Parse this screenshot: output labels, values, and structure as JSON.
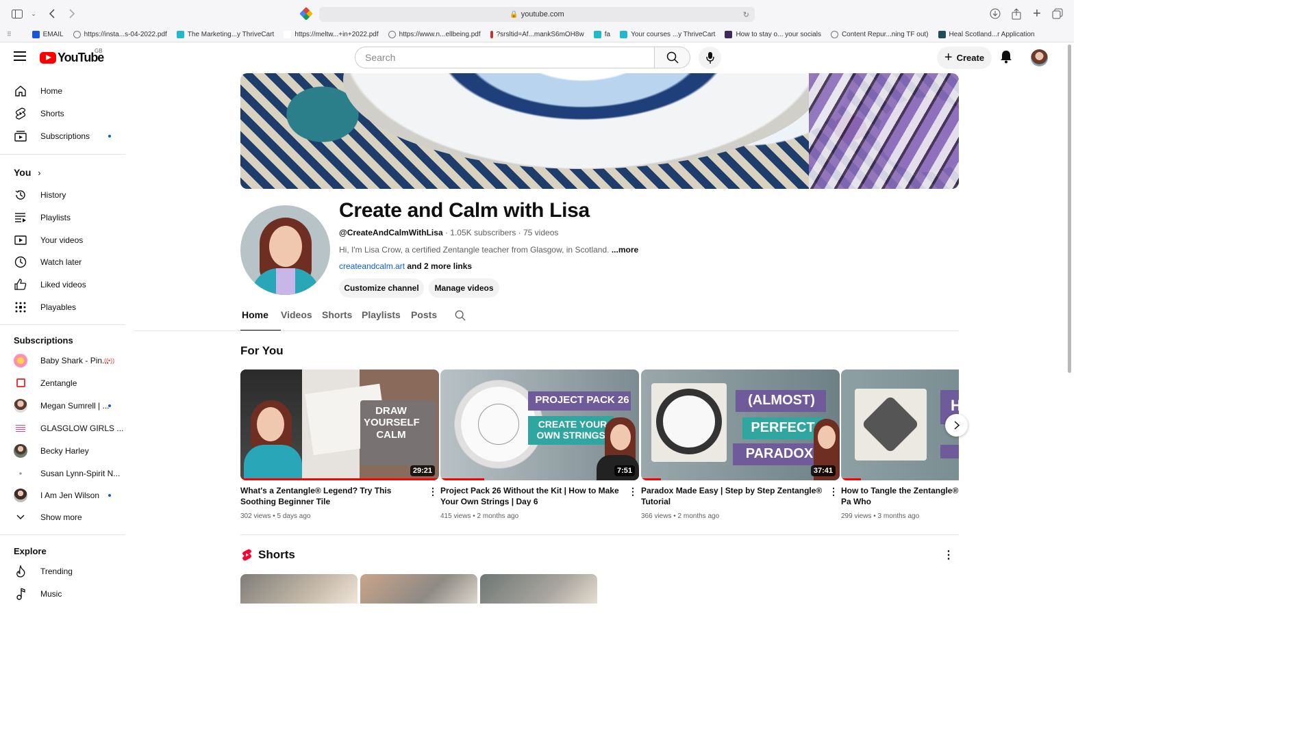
{
  "browser": {
    "url": "youtube.com",
    "bookmarks": [
      {
        "label": "EMAIL",
        "color": "#1a56db"
      },
      {
        "label": "https://insta...s-04-2022.pdf",
        "color": "#777777"
      },
      {
        "label": "The Marketing...y ThriveCart",
        "color": "#22b8cf"
      },
      {
        "label": "https://meltw...+in+2022.pdf",
        "color": "#ffffff"
      },
      {
        "label": "https://www.n...ellbeing.pdf",
        "color": "#777777"
      },
      {
        "label": "?srsltid=Af...mankS6mOH8w",
        "color": "#c0392b"
      },
      {
        "label": "fa",
        "color": "#22b8cf"
      },
      {
        "label": "Your courses ...y ThriveCart",
        "color": "#22b8cf"
      },
      {
        "label": "How to stay o... your socials",
        "color": "#3b2a5a"
      },
      {
        "label": "Content Repur...ning TF out)",
        "color": "#777777"
      },
      {
        "label": "Heal Scotland...r Application",
        "color": "#1f4e5a"
      }
    ]
  },
  "header": {
    "logo_text": "YouTube",
    "region": "GB",
    "search_placeholder": "Search",
    "create_label": "Create"
  },
  "sidebar": {
    "main": [
      {
        "label": "Home",
        "icon": "home-icon"
      },
      {
        "label": "Shorts",
        "icon": "shorts-icon"
      },
      {
        "label": "Subscriptions",
        "icon": "subscriptions-icon"
      }
    ],
    "you_label": "You",
    "you_items": [
      {
        "label": "History",
        "icon": "history-icon"
      },
      {
        "label": "Playlists",
        "icon": "playlists-icon"
      },
      {
        "label": "Your videos",
        "icon": "your-videos-icon"
      },
      {
        "label": "Watch later",
        "icon": "watch-later-icon"
      },
      {
        "label": "Liked videos",
        "icon": "liked-icon"
      },
      {
        "label": "Playables",
        "icon": "playables-icon"
      }
    ],
    "subscriptions_label": "Subscriptions",
    "subscriptions": [
      {
        "label": "Baby Shark - Pin...",
        "color": "#ff8fb1"
      },
      {
        "label": "Zentangle",
        "color": "#ffffff"
      },
      {
        "label": "Megan Sumrell | ...",
        "color": "#8a5a44"
      },
      {
        "label": "GLASGLOW GIRLS ...",
        "color": "#f4e1ea"
      },
      {
        "label": "Becky Harley",
        "color": "#6f7b6a"
      },
      {
        "label": "Susan Lynn-Spirit N...",
        "color": "#ffffff"
      },
      {
        "label": "I Am Jen Wilson",
        "color": "#3d2b25"
      }
    ],
    "show_more": "Show more",
    "explore_label": "Explore",
    "explore": [
      {
        "label": "Trending",
        "icon": "trending-icon"
      },
      {
        "label": "Music",
        "icon": "music-icon"
      }
    ]
  },
  "channel": {
    "name": "Create and Calm with Lisa",
    "handle": "@CreateAndCalmWithLisa",
    "stats": " · 1.05K subscribers · 75 videos",
    "description": "Hi, I'm Lisa Crow, a certified Zentangle teacher from Glasgow, in Scotland. ",
    "more": "...more",
    "link": "createandcalm.art",
    "more_links": " and 2 more links",
    "customize_label": "Customize channel",
    "manage_label": "Manage videos",
    "tabs": [
      "Home",
      "Videos",
      "Shorts",
      "Playlists",
      "Posts"
    ]
  },
  "for_you": {
    "title": "For You",
    "videos": [
      {
        "title": "What's a Zentangle® Legend? Try This Soothing Beginner Tile",
        "views": "302 views",
        "age": "5 days ago",
        "duration": "29:21",
        "overlay": "DRAW YOURSELF CALM",
        "progress": 1.0
      },
      {
        "title": "Project Pack 26 Without the Kit | How to Make Your Own Strings | Day 6",
        "views": "415 views",
        "age": "2 months ago",
        "duration": "7:51",
        "overlay_a": "PROJECT PACK 26",
        "overlay_b": "CREATE YOUR OWN STRINGS!",
        "progress": 0.22
      },
      {
        "title": "Paradox Made Easy | Step by Step Zentangle® Tutorial",
        "views": "366 views",
        "age": "2 months ago",
        "duration": "37:41",
        "overlay_a": "(ALMOST)",
        "overlay_b": "PERFECT",
        "overlay_c": "PARADOX",
        "progress": 0.1
      },
      {
        "title": "How to Tangle the Zentangle® Pa Who",
        "views": "299 views",
        "age": "3 months ago",
        "overlay_a": "H",
        "progress": 0.1
      }
    ]
  },
  "shorts": {
    "title": "Shorts"
  }
}
